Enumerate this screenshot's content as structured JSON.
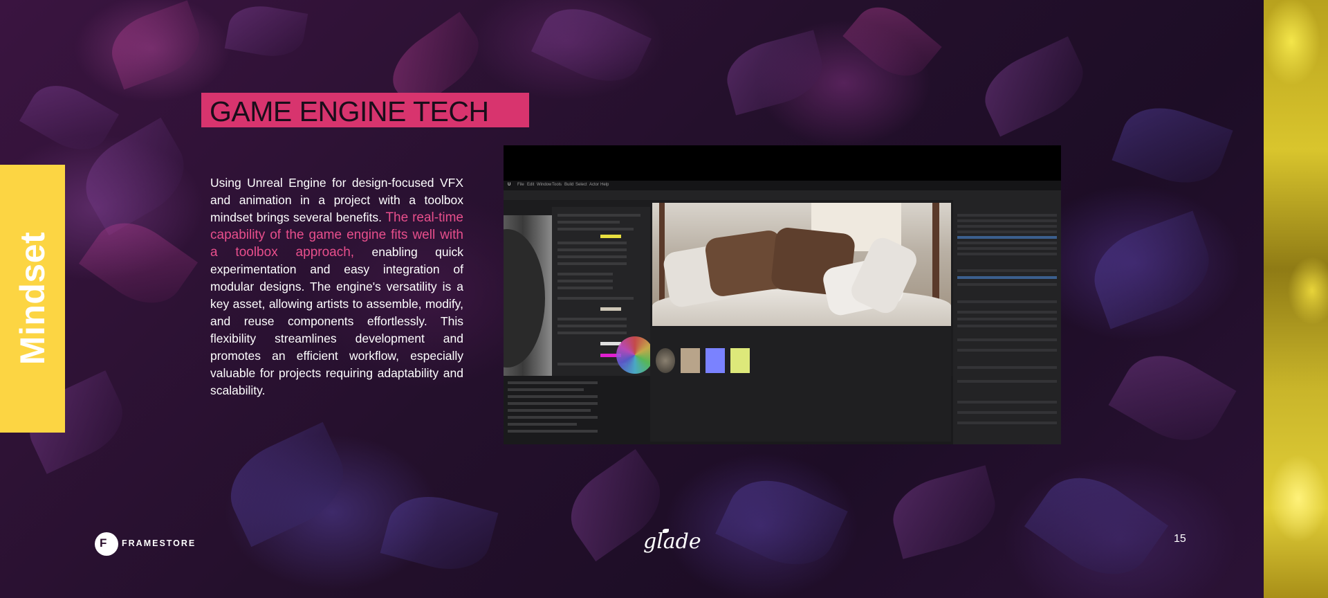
{
  "sidebar_tab": {
    "label": "Mindset"
  },
  "title": "GAME ENGINE TECH",
  "body": {
    "part1": "Using Unreal Engine for design-focused VFX and animation in a project with a toolbox mindset brings several benefits.",
    "highlight": "The real-time capability of the game engine fits well with a toolbox approach,",
    "part2": "enabling quick experimentation and easy integration of modular designs. The engine's versatility is a key asset, allowing artists to assemble, modify, and reuse components effortlessly. This flexibility streamlines development and promotes an efficient workflow, especially valuable for projects requiring adaptability and scalability."
  },
  "screenshot": {
    "menu_items": [
      "File",
      "Edit",
      "Window",
      "Tools",
      "Build",
      "Select",
      "Actor",
      "Help"
    ]
  },
  "footer": {
    "company": "FRAMESTORE",
    "company_mark": "F",
    "client_logo": "glade",
    "page_number": "15"
  },
  "colors": {
    "accent_pink": "#d8346e",
    "highlight_pink": "#e84f8c",
    "tab_yellow": "#fcd543"
  }
}
